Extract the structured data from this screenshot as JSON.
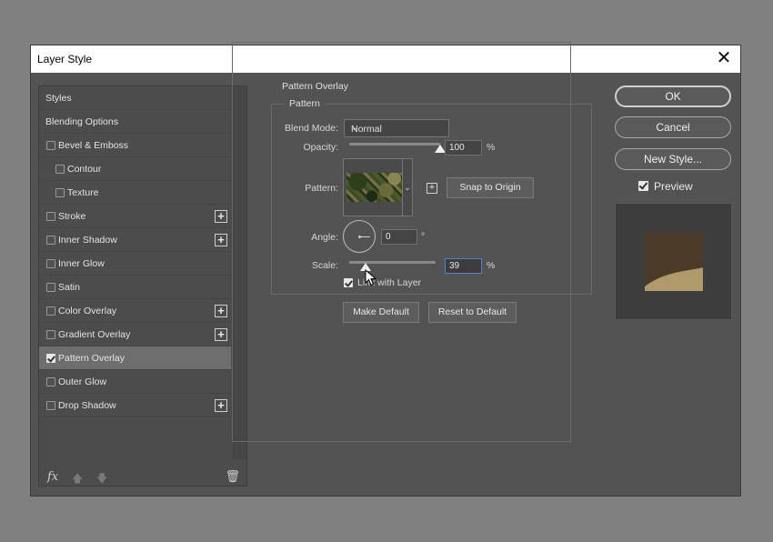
{
  "window": {
    "title": "Layer Style",
    "close_glyph": "✕"
  },
  "styles_list": {
    "items": [
      {
        "label": "Styles",
        "checkbox": false,
        "checked": false,
        "indent": false,
        "plus": false,
        "selected": false
      },
      {
        "label": "Blending Options",
        "checkbox": false,
        "checked": false,
        "indent": false,
        "plus": false,
        "selected": false
      },
      {
        "label": "Bevel & Emboss",
        "checkbox": true,
        "checked": false,
        "indent": false,
        "plus": false,
        "selected": false
      },
      {
        "label": "Contour",
        "checkbox": true,
        "checked": false,
        "indent": true,
        "plus": false,
        "selected": false
      },
      {
        "label": "Texture",
        "checkbox": true,
        "checked": false,
        "indent": true,
        "plus": false,
        "selected": false
      },
      {
        "label": "Stroke",
        "checkbox": true,
        "checked": false,
        "indent": false,
        "plus": true,
        "selected": false
      },
      {
        "label": "Inner Shadow",
        "checkbox": true,
        "checked": false,
        "indent": false,
        "plus": true,
        "selected": false
      },
      {
        "label": "Inner Glow",
        "checkbox": true,
        "checked": false,
        "indent": false,
        "plus": false,
        "selected": false
      },
      {
        "label": "Satin",
        "checkbox": true,
        "checked": false,
        "indent": false,
        "plus": false,
        "selected": false
      },
      {
        "label": "Color Overlay",
        "checkbox": true,
        "checked": false,
        "indent": false,
        "plus": true,
        "selected": false
      },
      {
        "label": "Gradient Overlay",
        "checkbox": true,
        "checked": false,
        "indent": false,
        "plus": true,
        "selected": false
      },
      {
        "label": "Pattern Overlay",
        "checkbox": true,
        "checked": true,
        "indent": false,
        "plus": false,
        "selected": true
      },
      {
        "label": "Outer Glow",
        "checkbox": true,
        "checked": false,
        "indent": false,
        "plus": false,
        "selected": false
      },
      {
        "label": "Drop Shadow",
        "checkbox": true,
        "checked": false,
        "indent": false,
        "plus": true,
        "selected": false
      }
    ],
    "footer": {
      "fx": "fx",
      "up_glyph": "🡅",
      "down_glyph": "🡇",
      "trash_glyph": "🗑"
    }
  },
  "pattern_overlay": {
    "group_title": "Pattern Overlay",
    "sub_title": "Pattern",
    "blend_mode": {
      "label": "Blend Mode:",
      "value": "Normal"
    },
    "opacity": {
      "label": "Opacity:",
      "value": "100",
      "unit": "%",
      "fraction": 1.0
    },
    "pattern": {
      "label": "Pattern:",
      "snap_button": "Snap to Origin",
      "new_preset_glyph": "+"
    },
    "angle": {
      "label": "Angle:",
      "value": "0",
      "unit": "°"
    },
    "scale": {
      "label": "Scale:",
      "value": "39",
      "unit": "%",
      "fraction": 0.19
    },
    "link_with_layer": {
      "label": "Link with Layer",
      "checked": true
    },
    "make_default": "Make Default",
    "reset_to_default": "Reset to Default"
  },
  "actions": {
    "ok": "OK",
    "cancel": "Cancel",
    "new_style": "New Style..."
  },
  "preview": {
    "label": "Preview",
    "checked": true
  }
}
